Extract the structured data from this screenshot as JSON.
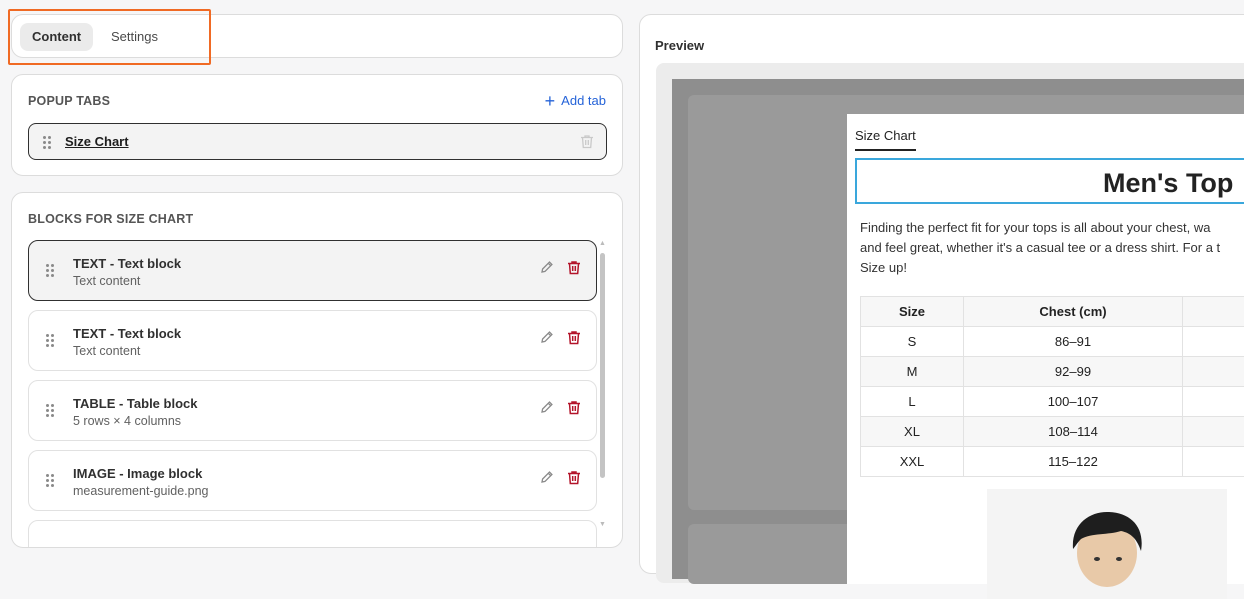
{
  "tabs": {
    "content_label": "Content",
    "settings_label": "Settings"
  },
  "popup_tabs": {
    "title": "POPUP TABS",
    "add_tab_label": "Add tab",
    "items": [
      {
        "label": "Size Chart"
      }
    ]
  },
  "blocks": {
    "title": "BLOCKS FOR SIZE CHART",
    "items": [
      {
        "title": "TEXT - Text block",
        "subtitle": "Text content"
      },
      {
        "title": "TEXT - Text block",
        "subtitle": "Text content"
      },
      {
        "title": "TABLE - Table block",
        "subtitle": "5 rows × 4 columns"
      },
      {
        "title": "IMAGE - Image block",
        "subtitle": "measurement-guide.png"
      }
    ]
  },
  "preview": {
    "label": "Preview",
    "modal_tab": "Size Chart",
    "heading": "Men's Top",
    "description": [
      "Finding the perfect fit for your tops is all about your chest, wa",
      "and feel great, whether it's a casual tee or a dress shirt. For a t",
      "Size up!"
    ],
    "table": {
      "headers": [
        "Size",
        "Chest (cm)",
        ""
      ],
      "rows": [
        [
          "S",
          "86–91",
          ""
        ],
        [
          "M",
          "92–99",
          ""
        ],
        [
          "L",
          "100–107",
          ""
        ],
        [
          "XL",
          "108–114",
          ""
        ],
        [
          "XXL",
          "115–122",
          ""
        ]
      ]
    }
  },
  "colors": {
    "highlight": "#f06a24",
    "link": "#2563d8",
    "delete": "#b3142a",
    "heading_border": "#3aa7dc"
  }
}
